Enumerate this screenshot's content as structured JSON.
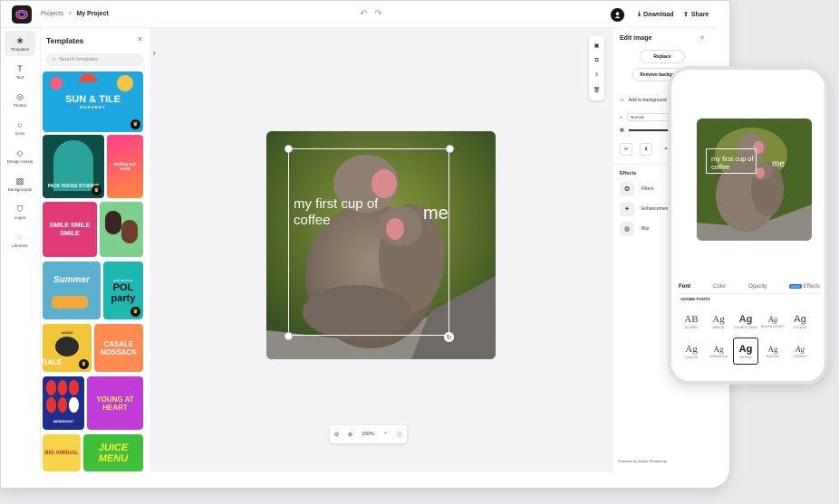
{
  "topbar": {
    "breadcrumb_parent": "Projects",
    "breadcrumb_sep": ">",
    "breadcrumb_current": "My Project",
    "download_label": "Download",
    "share_label": "Share"
  },
  "toolrail": {
    "items": [
      {
        "label": "Templates",
        "icon": "templates-icon",
        "glyph": "❀"
      },
      {
        "label": "Text",
        "icon": "text-icon",
        "glyph": "T"
      },
      {
        "label": "Photos",
        "icon": "photos-icon",
        "glyph": "◎"
      },
      {
        "label": "Icons",
        "icon": "icons-icon",
        "glyph": "○"
      },
      {
        "label": "Design Assets",
        "icon": "design-assets-icon",
        "glyph": "◇"
      },
      {
        "label": "Backgrounds",
        "icon": "backgrounds-icon",
        "glyph": "▧"
      },
      {
        "label": "Logos",
        "icon": "logos-icon",
        "glyph": "⛉"
      },
      {
        "label": "Libraries",
        "icon": "libraries-icon",
        "glyph": "◌"
      }
    ]
  },
  "templates": {
    "title": "Templates",
    "search_placeholder": "Search templates",
    "cards": [
      {
        "text": "SUN & TILE",
        "sub": "NURSERY"
      },
      {
        "text": "PACK HOUSE STUDIOS",
        "sub": ""
      },
      {
        "text": "Rolling Out Food",
        "sub": ""
      },
      {
        "text": "SMILE SMILE SMILE",
        "sub": ""
      },
      {
        "text": "",
        "sub": ""
      },
      {
        "text": "Summer",
        "sub": ""
      },
      {
        "text": "POL party",
        "sub": "join us for a"
      },
      {
        "text": "SALE",
        "sub": "AUDIO"
      },
      {
        "text": "CASALE NOSSACK",
        "sub": ""
      },
      {
        "text": "MINDSIGHT",
        "sub": ""
      },
      {
        "text": "YOUNG AT HEART",
        "sub": ""
      },
      {
        "text": "BIG ANNUAL",
        "sub": ""
      },
      {
        "text": "JUICE MENU",
        "sub": ""
      }
    ]
  },
  "canvas": {
    "caption_main": "my first cup of coffee",
    "caption_side": "me",
    "zoom": "150%"
  },
  "edit_panel": {
    "title": "Edit image",
    "replace_label": "Replace",
    "remove_bg_label": "Remove background",
    "add_to_bg_label": "Add to background",
    "blend_value": "Normal",
    "effects_title": "Effects",
    "effects": [
      "Filters",
      "Enhancements",
      "Blur"
    ],
    "powered_by": "Powered by Adobe Photoshop"
  },
  "phone": {
    "caption_main": "my first cup of coffee",
    "caption_side": "me",
    "tabs": [
      "Font",
      "Color",
      "Opacity",
      "Effects"
    ],
    "new_badge": "NEW",
    "fonts_header": "ADOBE FONTS",
    "font_samples": [
      {
        "glyph": "AB",
        "name": "ACUMIN"
      },
      {
        "glyph": "Ag",
        "name": "MINION"
      },
      {
        "glyph": "Ag",
        "name": "SOURCE SANS"
      },
      {
        "glyph": "Ag",
        "name": "BRUSH SCRIPT"
      },
      {
        "glyph": "Ag",
        "name": "FUTURA"
      },
      {
        "glyph": "Ag",
        "name": "CASLON"
      },
      {
        "glyph": "Ag",
        "name": "GARAMOND"
      },
      {
        "glyph": "Ag",
        "name": "MYRIAD"
      },
      {
        "glyph": "Ag",
        "name": "BODONI"
      },
      {
        "glyph": "Ag",
        "name": "CURSIVE"
      }
    ]
  }
}
